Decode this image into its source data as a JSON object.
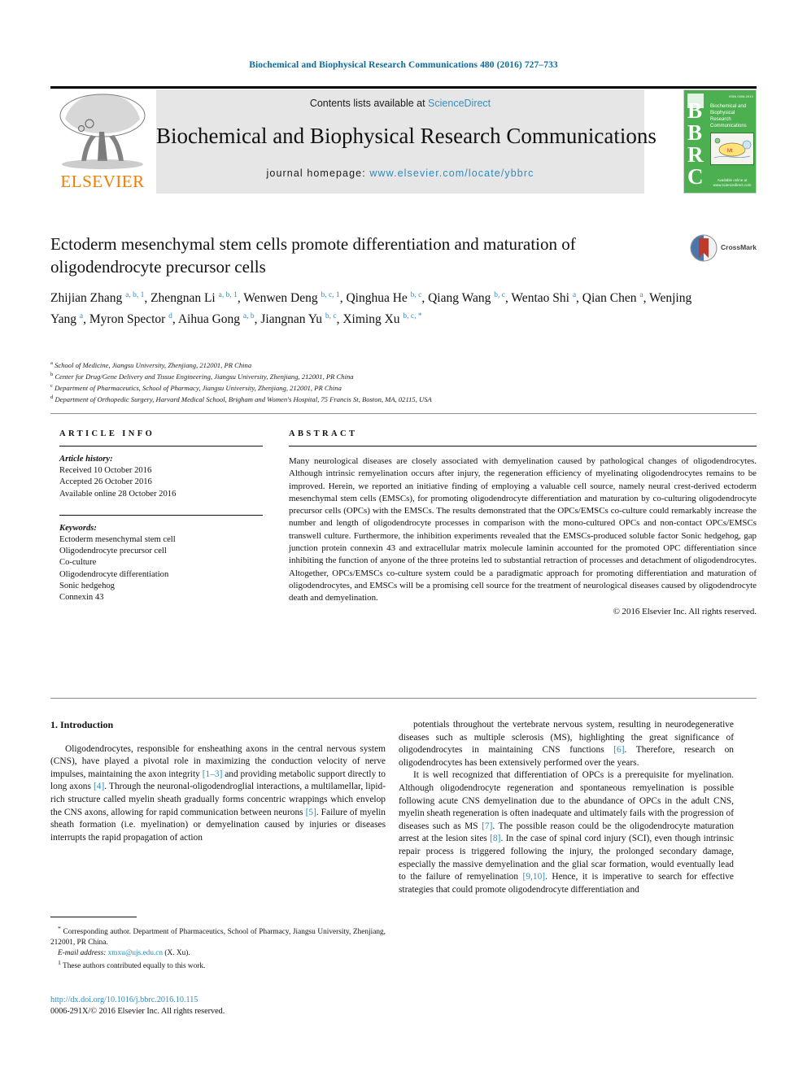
{
  "running_head": "Biochemical and Biophysical Research Communications 480 (2016) 727–733",
  "header": {
    "publisher_name": "ELSEVIER",
    "contents_prefix": "Contents lists available at ",
    "contents_link": "ScienceDirect",
    "journal_title": "Biochemical and Biophysical Research Communications",
    "homepage_prefix": "journal homepage: ",
    "homepage_url": "www.elsevier.com/locate/ybbrc",
    "cover": {
      "acronym": "BBRC",
      "title_lines": "Biochemical and Biophysical Research Communications",
      "issn_corner": "ISSN 0006-291X",
      "footer": "Available online at www.sciencedirect.com"
    }
  },
  "article": {
    "title": "Ectoderm mesenchymal stem cells promote differentiation and maturation of oligodendrocyte precursor cells",
    "crossmark_label": "CrossMark",
    "authors_html": "Zhijian Zhang <sup>a, b, 1</sup>, Zhengnan Li <sup>a, b, 1</sup>, Wenwen Deng <sup>b, c, 1</sup>, Qinghua He <sup>b, c</sup>, Qiang Wang <sup>b, c</sup>, Wentao Shi <sup>a</sup>, Qian Chen <sup>a</sup>, Wenjing Yang <sup>a</sup>, Myron Spector <sup>d</sup>, Aihua Gong <sup>a, b</sup>, Jiangnan Yu <sup>b, c</sup>, Ximing Xu <sup>b, c, *</sup>",
    "affiliations": [
      {
        "mark": "a",
        "text": "School of Medicine, Jiangsu University, Zhenjiang, 212001, PR China"
      },
      {
        "mark": "b",
        "text": "Center for Drug/Gene Delivery and Tissue Engineering, Jiangsu University, Zhenjiang, 212001, PR China"
      },
      {
        "mark": "c",
        "text": "Department of Pharmaceutics, School of Pharmacy, Jiangsu University, Zhenjiang, 212001, PR China"
      },
      {
        "mark": "d",
        "text": "Department of Orthopedic Surgery, Harvard Medical School, Brigham and Women's Hospital, 75 Francis St, Boston, MA, 02115, USA"
      }
    ]
  },
  "article_info": {
    "heading": "ARTICLE INFO",
    "history_label": "Article history:",
    "history": [
      "Received 10 October 2016",
      "Accepted 26 October 2016",
      "Available online 28 October 2016"
    ],
    "keywords_label": "Keywords:",
    "keywords": [
      "Ectoderm mesenchymal stem cell",
      "Oligodendrocyte precursor cell",
      "Co-culture",
      "Oligodendrocyte differentiation",
      "Sonic hedgehog",
      "Connexin 43"
    ]
  },
  "abstract": {
    "heading": "ABSTRACT",
    "body": "Many neurological diseases are closely associated with demyelination caused by pathological changes of oligodendrocytes. Although intrinsic remyelination occurs after injury, the regeneration efficiency of myelinating oligodendrocytes remains to be improved. Herein, we reported an initiative finding of employing a valuable cell source, namely neural crest-derived ectoderm mesenchymal stem cells (EMSCs), for promoting oligodendrocyte differentiation and maturation by co-culturing oligodendrocyte precursor cells (OPCs) with the EMSCs. The results demonstrated that the OPCs/EMSCs co-culture could remarkably increase the number and length of oligodendrocyte processes in comparison with the mono-cultured OPCs and non-contact OPCs/EMSCs transwell culture. Furthermore, the inhibition experiments revealed that the EMSCs-produced soluble factor Sonic hedgehog, gap junction protein connexin 43 and extracellular matrix molecule laminin accounted for the promoted OPC differentiation since inhibiting the function of anyone of the three proteins led to substantial retraction of processes and detachment of oligodendrocytes. Altogether, OPCs/EMSCs co-culture system could be a paradigmatic approach for promoting differentiation and maturation of oligodendrocytes, and EMSCs will be a promising cell source for the treatment of neurological diseases caused by oligodendrocyte death and demyelination.",
    "copyright": "© 2016 Elsevier Inc. All rights reserved."
  },
  "body": {
    "section_number_title": "1. Introduction",
    "left_paragraph_html": "Oligodendrocytes, responsible for ensheathing axons in the central nervous system (CNS), have played a pivotal role in maximizing the conduction velocity of nerve impulses, maintaining the axon integrity <span class=\"ref\">[1–3]</span> and providing metabolic support directly to long axons <span class=\"ref\">[4]</span>. Through the neuronal-oligodendroglial interactions, a multilamellar, lipid-rich structure called myelin sheath gradually forms concentric wrappings which envelop the CNS axons, allowing for rapid communication between neurons <span class=\"ref\">[5]</span>. Failure of myelin sheath formation (i.e. myelination) or demyelination caused by injuries or diseases interrupts the rapid propagation of action",
    "right_paragraph_1_html": "potentials throughout the vertebrate nervous system, resulting in neurodegenerative diseases such as multiple sclerosis (MS), highlighting the great significance of oligodendrocytes in maintaining CNS functions <span class=\"ref\">[6]</span>. Therefore, research on oligodendrocytes has been extensively performed over the years.",
    "right_paragraph_2_html": "It is well recognized that differentiation of OPCs is a prerequisite for myelination. Although oligodendrocyte regeneration and spontaneous remyelination is possible following acute CNS demyelination due to the abundance of OPCs in the adult CNS, myelin sheath regeneration is often inadequate and ultimately fails with the progression of diseases such as MS <span class=\"ref\">[7]</span>. The possible reason could be the oligodendrocyte maturation arrest at the lesion sites <span class=\"ref\">[8]</span>. In the case of spinal cord injury (SCI), even though intrinsic repair process is triggered following the injury, the prolonged secondary damage, especially the massive demyelination and the glial scar formation, would eventually lead to the failure of remyelination <span class=\"ref\">[9,10]</span>. Hence, it is imperative to search for effective strategies that could promote oligodendrocyte differentiation and"
  },
  "footnotes": {
    "corresponding_html": "<sup>*</sup> Corresponding author. Department of Pharmaceutics, School of Pharmacy, Jiangsu University, Zhenjiang, 212001, PR China.",
    "email_html": "<i>E-mail address:</i> <span class=\"mail\">xmxu@ujs.edu.cn</span> (X. Xu).",
    "equal_contrib_html": "<sup>1</sup> These authors contributed equally to this work."
  },
  "imprint": {
    "doi": "http://dx.doi.org/10.1016/j.bbrc.2016.10.115",
    "issn_line": "0006-291X/© 2016 Elsevier Inc. All rights reserved."
  }
}
